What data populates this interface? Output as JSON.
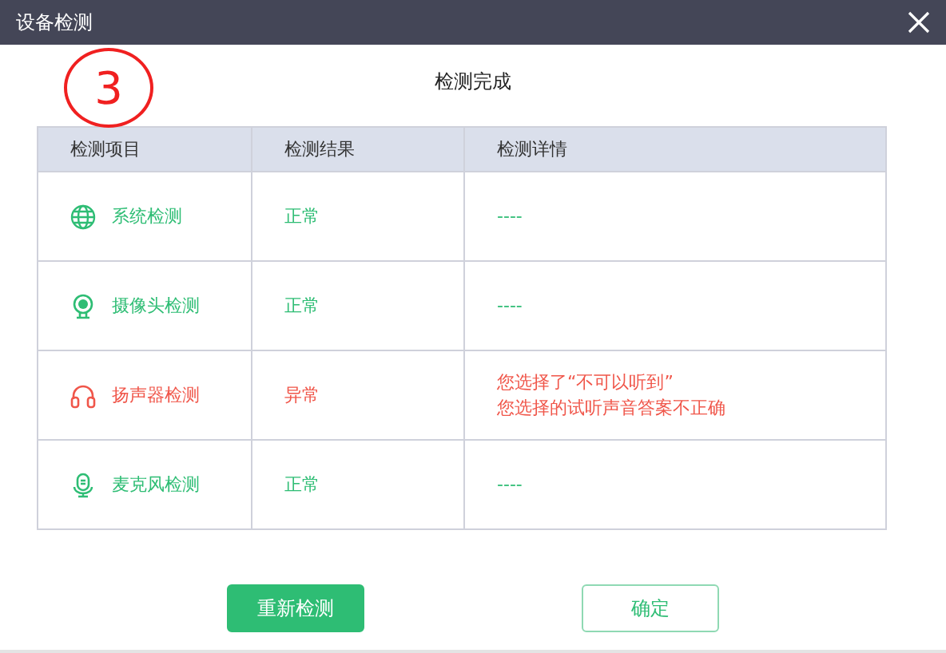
{
  "window": {
    "title": "设备检测"
  },
  "annotation": "3",
  "heading": "检测完成",
  "table": {
    "columns": [
      "检测项目",
      "检测结果",
      "检测详情"
    ],
    "rows": [
      {
        "kind": "globe",
        "item": "系统检测",
        "error": false,
        "result": "正常",
        "details": [
          "----"
        ]
      },
      {
        "kind": "webcam",
        "item": "摄像头检测",
        "error": false,
        "result": "正常",
        "details": [
          "----"
        ]
      },
      {
        "kind": "headphones",
        "item": "扬声器检测",
        "error": true,
        "result": "异常",
        "details": [
          "您选择了“不可以听到”",
          "您选择的试听声音答案不正确"
        ]
      },
      {
        "kind": "microphone",
        "item": "麦克风检测",
        "error": false,
        "result": "正常",
        "details": [
          "----"
        ]
      }
    ]
  },
  "buttons": [
    {
      "kind": "primary",
      "label": "重新检测"
    },
    {
      "kind": "secondary",
      "label": "确定"
    }
  ]
}
